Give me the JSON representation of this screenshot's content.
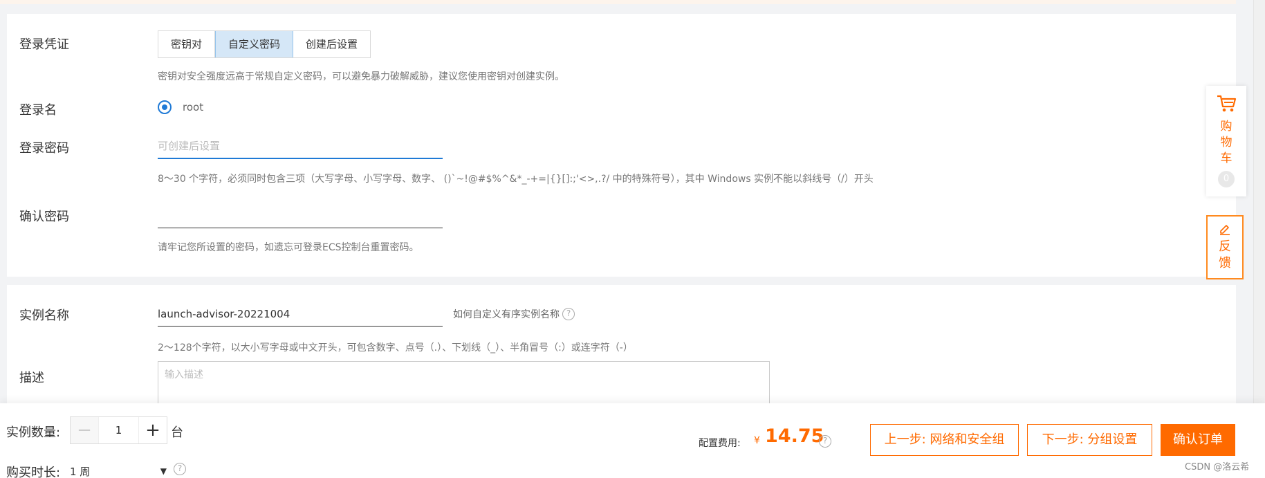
{
  "login": {
    "credential_label": "登录凭证",
    "credential_options": [
      "密钥对",
      "自定义密码",
      "创建后设置"
    ],
    "credential_hint": "密钥对安全强度远高于常规自定义密码，可以避免暴力破解威胁，建议您使用密钥对创建实例。",
    "name_label": "登录名",
    "name_value": "root",
    "password_label": "登录密码",
    "password_placeholder": "可创建后设置",
    "password_rule": "8～30 个字符，必须同时包含三项（大写字母、小写字母、数字、 ()`~!@#$%^&*_-+=|{}[]:;'<>,.?/ 中的特殊符号），其中 Windows 实例不能以斜线号（/）开头",
    "confirm_label": "确认密码",
    "confirm_hint": "请牢记您所设置的密码，如遗忘可登录ECS控制台重置密码。"
  },
  "instance": {
    "name_label": "实例名称",
    "name_value": "launch-advisor-20221004",
    "name_help_link": "如何自定义有序实例名称",
    "name_rule": "2～128个字符，以大小写字母或中文开头，可包含数字、点号（.）、下划线（_）、半角冒号（:）或连字符（-）",
    "desc_label": "描述",
    "desc_placeholder": "输入描述"
  },
  "bottom": {
    "qty_label": "实例数量:",
    "qty_minus": "−",
    "qty_value": "1",
    "qty_plus": "+",
    "qty_unit": "台",
    "duration_label": "购买时长:",
    "duration_value": "1 周",
    "cost_label": "配置费用:",
    "cost_currency": "¥",
    "cost_value": "14.75",
    "prev_button": "上一步: 网络和安全组",
    "next_button": "下一步: 分组设置",
    "confirm_button": "确认订单"
  },
  "side": {
    "cart_label": "购物车",
    "cart_count": "0",
    "feedback_label": "反馈"
  },
  "watermark": "CSDN @洛云希",
  "colors": {
    "accent": "#ff6a00",
    "primary_blue": "#1f7ad6",
    "segment_active": "#d5e7f7"
  },
  "icons": [
    "cart-icon",
    "edit-icon",
    "question-icon",
    "caret-down-icon",
    "radio-checked-icon"
  ]
}
